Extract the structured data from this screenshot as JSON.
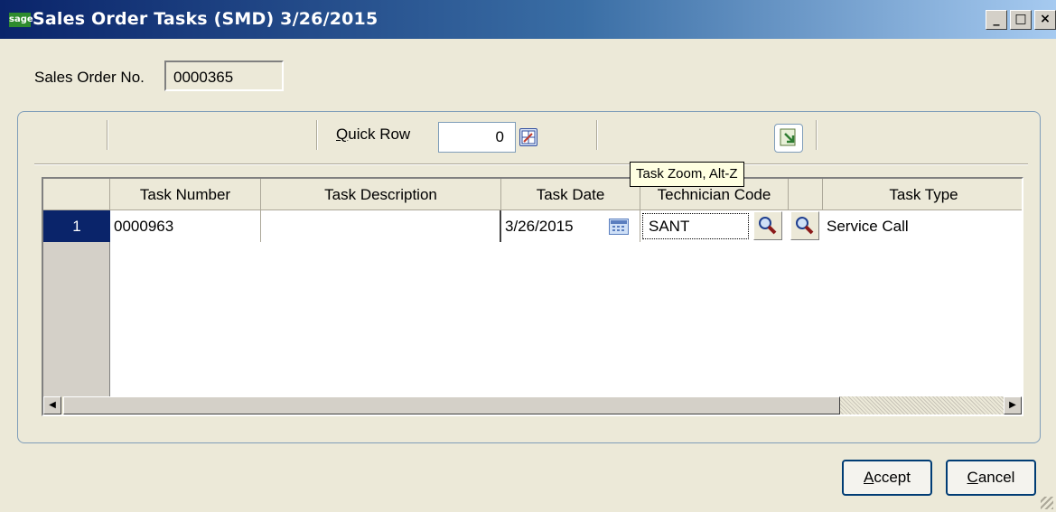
{
  "window": {
    "app_icon": "sage",
    "title": "Sales Order Tasks (SMD) 3/26/2015",
    "controls": [
      "_",
      "□",
      "×"
    ]
  },
  "header": {
    "sales_order_label": "Sales Order No.",
    "sales_order_value": "0000365"
  },
  "toolbar": {
    "quick_row_label_u": "Q",
    "quick_row_label_rest": "uick Row",
    "quick_row_value": "0",
    "task_zoom_tooltip": "Task Zoom, Alt-Z"
  },
  "grid": {
    "columns": [
      "Task Number",
      "Task Description",
      "Task Date",
      "Technician Code",
      "Task Type"
    ],
    "rows": [
      {
        "row_number": "1",
        "task_number": "0000963",
        "task_description": "",
        "task_date": "3/26/2015",
        "technician_code": "SANT",
        "task_type": "Service Call"
      }
    ]
  },
  "buttons": {
    "accept_u": "A",
    "accept_rest": "ccept",
    "cancel_u": "C",
    "cancel_rest": "ancel"
  },
  "colors": {
    "title_bar": "#0a246a",
    "selected_row": "#0a246a",
    "tooltip_bg": "#ffffe1"
  }
}
